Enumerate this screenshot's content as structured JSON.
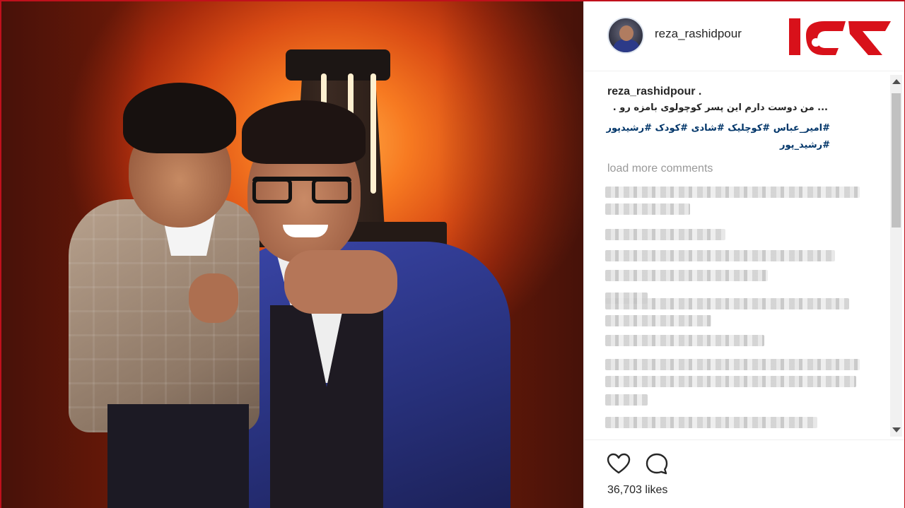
{
  "post": {
    "username": "reza_rashidpour",
    "caption_user": "reza_rashidpour .",
    "caption_text": "... من دوست دارم این پسر کوچولوی بامزه رو .",
    "hashtags_line1": "#امیر_عباس #کوچلیک #شادی #کودک #رشیدپور",
    "hashtags_line2": "#رشید_پور",
    "load_more": "load more comments",
    "likes": "36,703 likes"
  },
  "icons": {
    "heart": "heart-icon",
    "comment": "comment-icon"
  },
  "colors": {
    "frame": "#c0101c",
    "link": "#003569",
    "muted": "#999999"
  }
}
